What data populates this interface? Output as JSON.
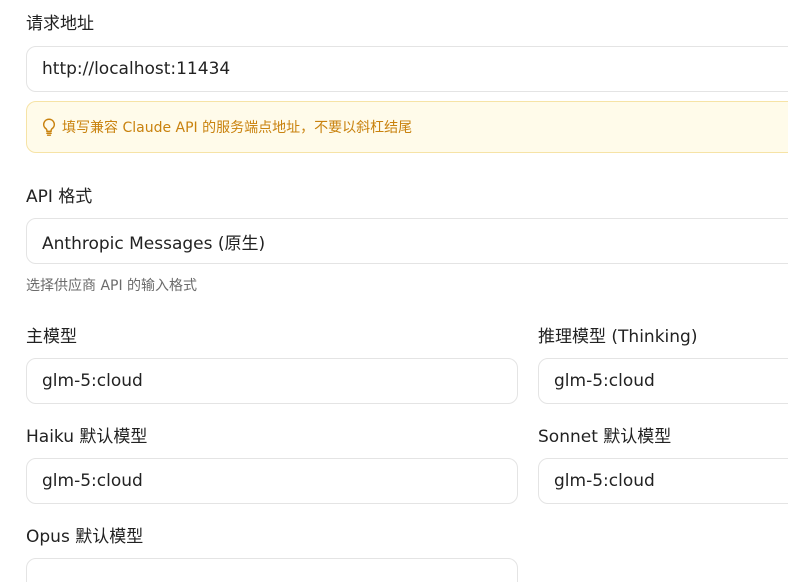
{
  "endpoint": {
    "label": "请求地址",
    "value": "http://localhost:11434",
    "hint": "填写兼容 Claude API 的服务端点地址，不要以斜杠结尾"
  },
  "api_format": {
    "label": "API 格式",
    "value": "Anthropic Messages (原生)",
    "helper": "选择供应商 API 的输入格式"
  },
  "models": {
    "main": {
      "label": "主模型",
      "value": "glm-5:cloud"
    },
    "reasoning": {
      "label": "推理模型 (Thinking)",
      "value": "glm-5:cloud"
    },
    "haiku": {
      "label": "Haiku 默认模型",
      "value": "glm-5:cloud"
    },
    "sonnet": {
      "label": "Sonnet 默认模型",
      "value": "glm-5:cloud"
    },
    "opus": {
      "label": "Opus 默认模型",
      "value": ""
    }
  },
  "colors": {
    "hint_text": "#c9820e",
    "hint_bg": "#fffbea",
    "hint_border": "#f6e3a6",
    "input_border": "#e4e4e4"
  },
  "icons": {
    "hint": "lightbulb-icon"
  }
}
